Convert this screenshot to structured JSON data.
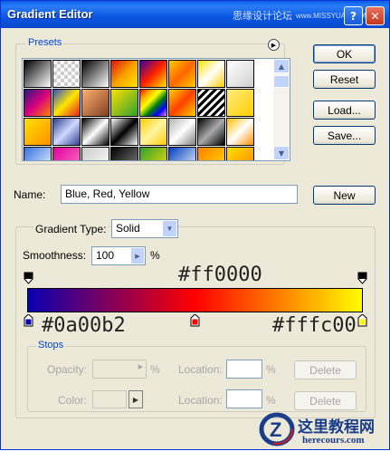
{
  "window": {
    "title": "Gradient Editor",
    "watermark": "思缘设计论坛",
    "watermark_url": "www.MISSYUAN.COM"
  },
  "buttons": {
    "ok": "OK",
    "reset": "Reset",
    "load": "Load...",
    "save": "Save...",
    "new": "New"
  },
  "presets": {
    "label": "Presets"
  },
  "name_field": {
    "label": "Name:",
    "value": "Blue, Red, Yellow"
  },
  "gradient": {
    "type_label": "Gradient Type:",
    "type_value": "Solid",
    "smoothness_label": "Smoothness:",
    "smoothness_value": "100",
    "smoothness_unit": "%"
  },
  "annotations": {
    "top_hex": "#ff0000",
    "left_hex": "#0a00b2",
    "right_hex": "#fffc00"
  },
  "stops": {
    "label": "Stops",
    "opacity_label": "Opacity:",
    "opacity_unit": "%",
    "location_label": "Location:",
    "location_unit": "%",
    "color_label": "Color:",
    "delete_label": "Delete"
  },
  "logo": {
    "site_name": "这里教程网",
    "url": "herecours.com"
  },
  "colors": {
    "stop_left": "#0a00b2",
    "stop_mid": "#ff0000",
    "stop_right": "#fffc00"
  }
}
